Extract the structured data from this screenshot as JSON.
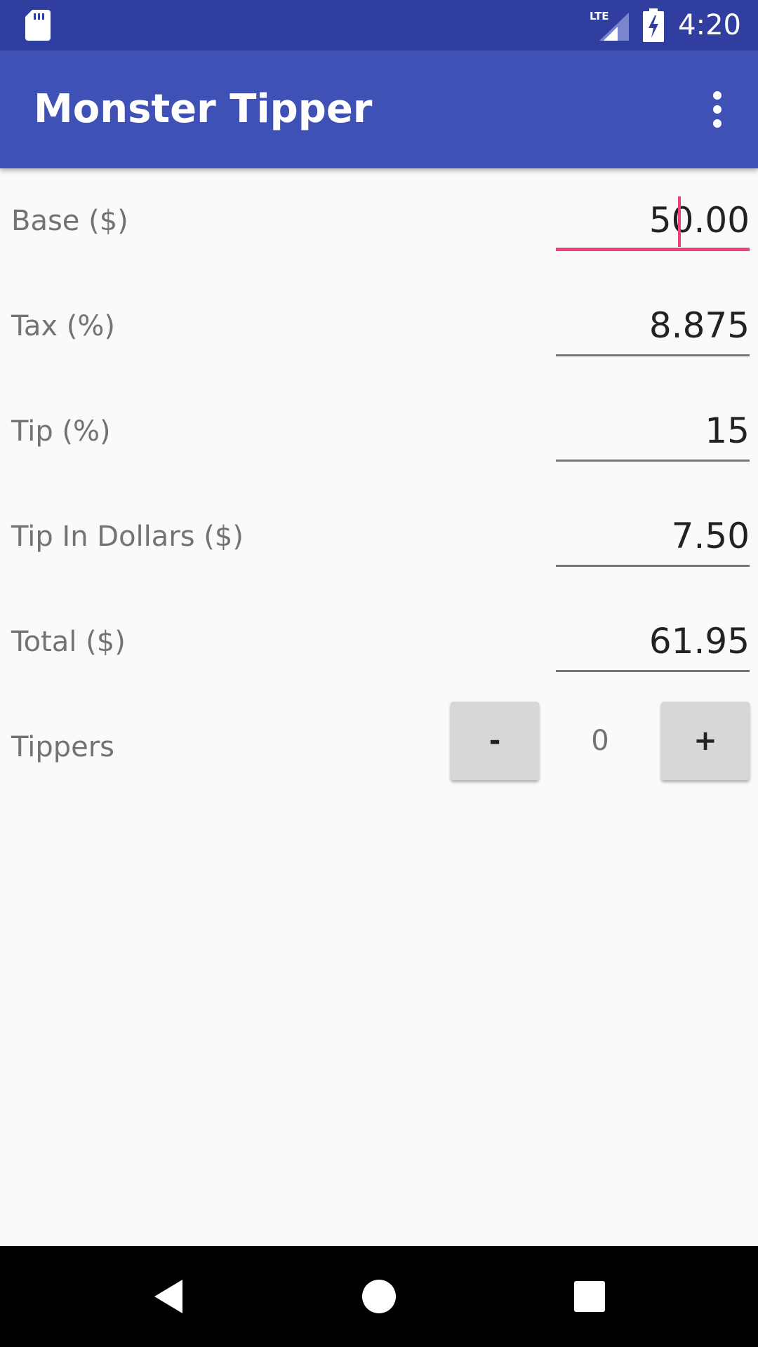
{
  "status_bar": {
    "time": "4:20",
    "network_label": "LTE",
    "icons": [
      "sd-card-icon",
      "lte-signal-icon",
      "battery-charging-icon"
    ]
  },
  "app_bar": {
    "title": "Monster Tipper",
    "overflow_icon": "overflow-menu-icon"
  },
  "form": {
    "base": {
      "label": "Base ($)",
      "value": "50.00",
      "focused": true
    },
    "tax": {
      "label": "Tax (%)",
      "value": "8.875"
    },
    "tip": {
      "label": "Tip (%)",
      "value": "15"
    },
    "tip_dollars": {
      "label": "Tip In Dollars ($)",
      "value": "7.50"
    },
    "total": {
      "label": "Total ($)",
      "value": "61.95"
    },
    "tippers": {
      "label": "Tippers",
      "count": "0",
      "decrement_label": "-",
      "increment_label": "+"
    }
  },
  "nav_bar": {
    "icons": [
      "back-icon",
      "home-icon",
      "recents-icon"
    ]
  },
  "colors": {
    "status_bar": "#303f9f",
    "app_bar": "#3f51b5",
    "accent": "#ec407a",
    "background": "#fafafa",
    "button": "#d6d7d7"
  }
}
